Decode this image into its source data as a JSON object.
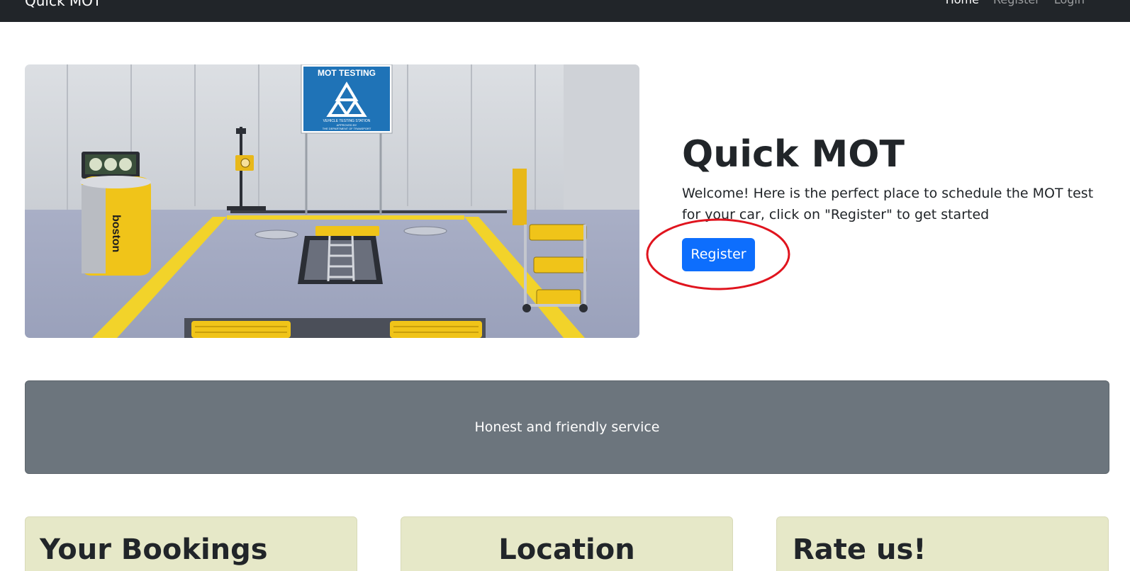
{
  "navbar": {
    "brand": "Quick MOT",
    "links": [
      "Home",
      "Register",
      "Login"
    ]
  },
  "hero": {
    "image_alt": "MOT testing bay illustration",
    "sign_title": "MOT TESTING",
    "sign_subtitle": "VEHICLE TESTING STATION",
    "sign_approved": "APPROVED BY",
    "sign_department": "THE DEPARTMENT OF TRANSPORT",
    "machine_brand": "boston",
    "title": "Quick MOT",
    "lead": "Welcome! Here is the perfect place to schedule the MOT test for your car, click on \"Register\" to get started",
    "button_label": "Register",
    "annotation_color": "#e0141e"
  },
  "banner": {
    "text": "Honest and friendly service"
  },
  "cards": [
    {
      "title": "Your Bookings"
    },
    {
      "title": "Location"
    },
    {
      "title": "Rate us!"
    }
  ],
  "colors": {
    "navbar_bg": "#212529",
    "primary": "#0d6efd",
    "banner_bg": "#6c757d",
    "card_bg": "#e6e8c8"
  }
}
